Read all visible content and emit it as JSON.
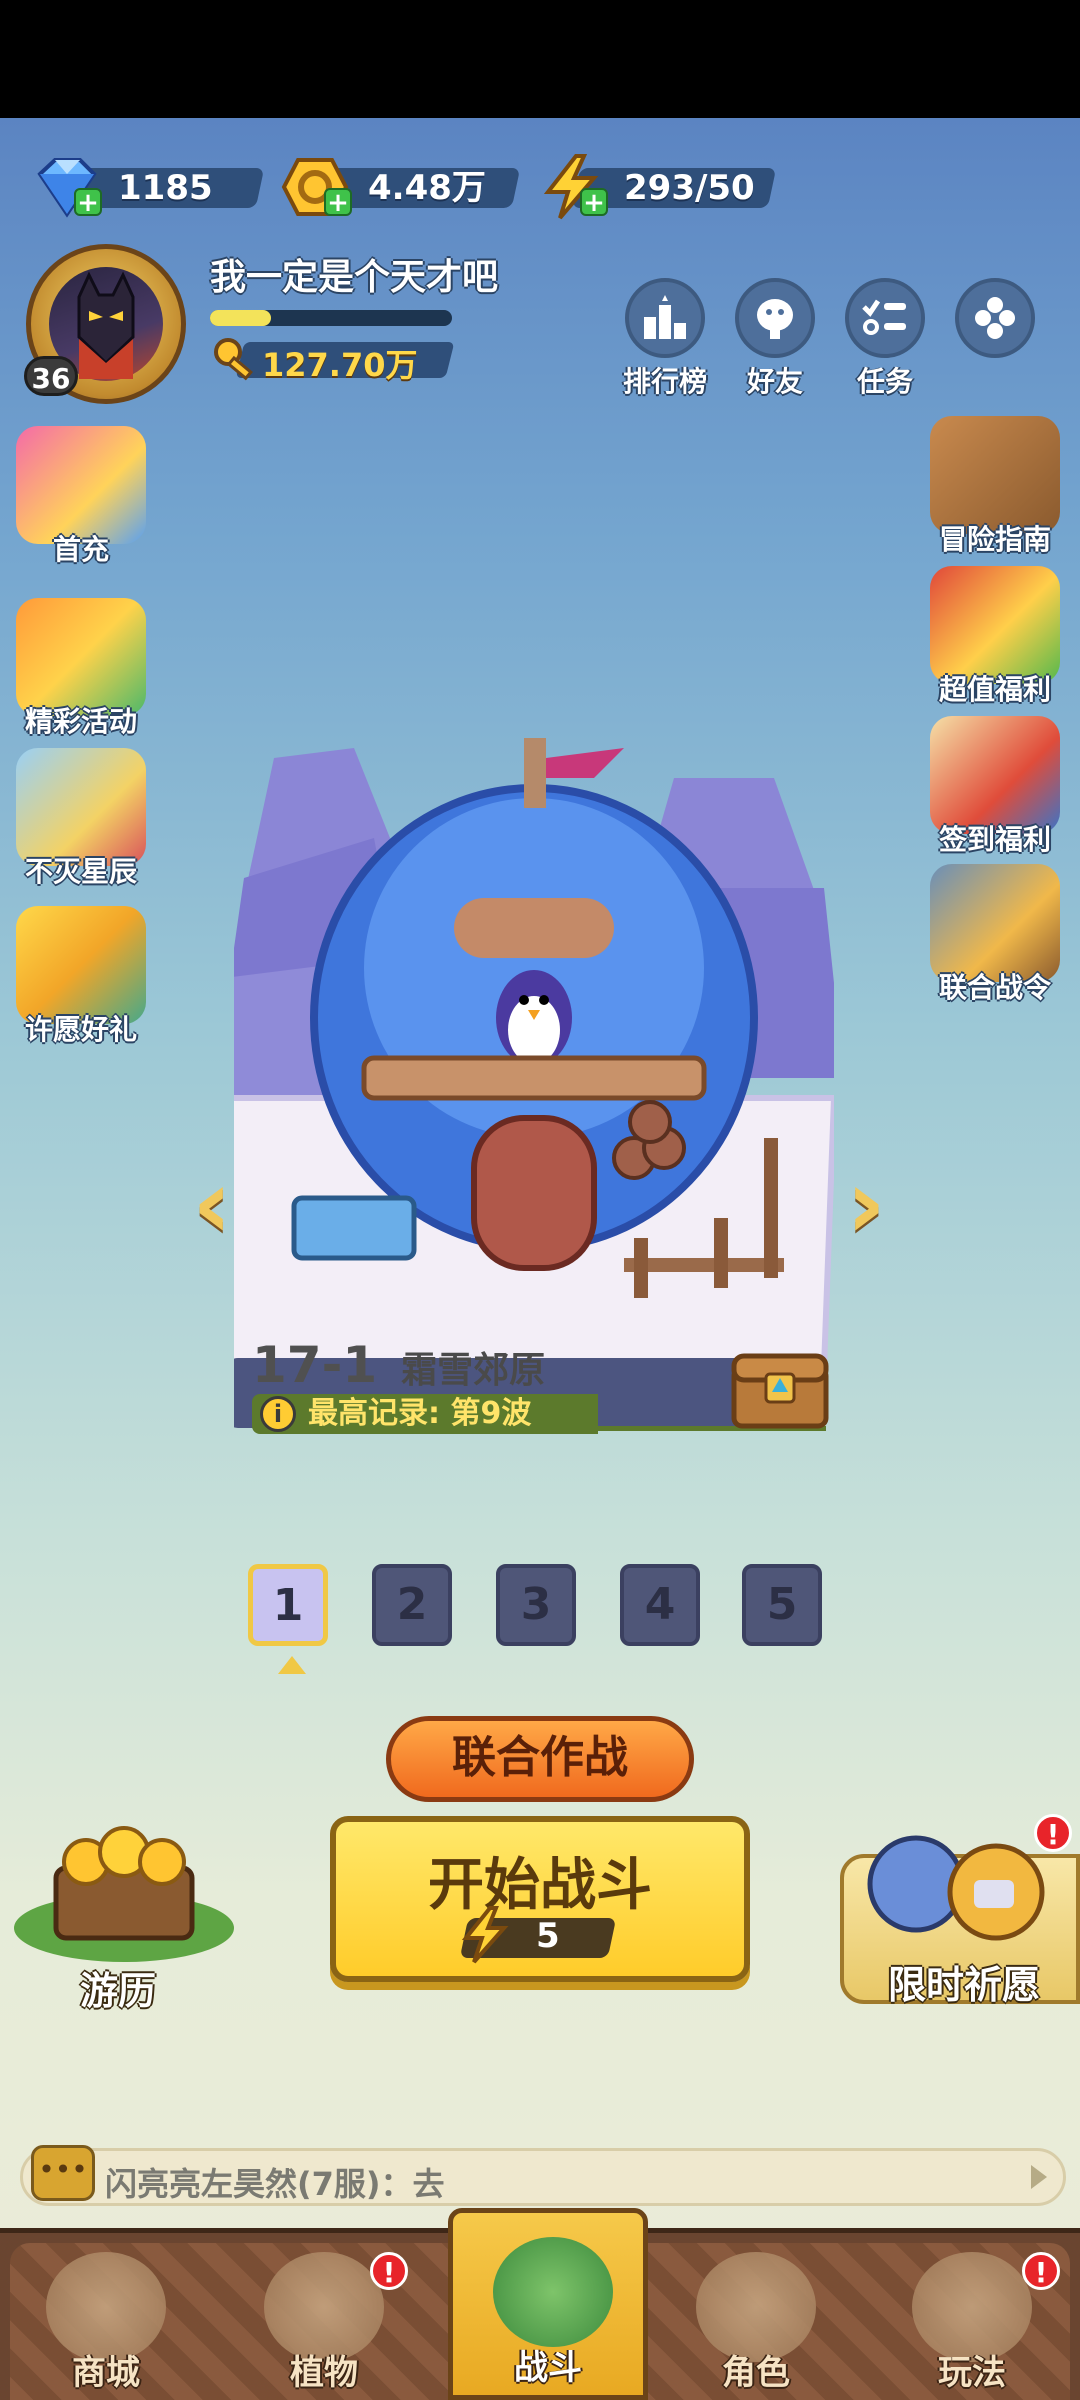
{
  "currencies": [
    {
      "name": "diamond",
      "icon": "diamond-icon",
      "value": "1185"
    },
    {
      "name": "gold",
      "icon": "gold-coin-icon",
      "value": "4.48万"
    },
    {
      "name": "energy",
      "icon": "lightning-icon",
      "value": "293/50"
    }
  ],
  "player": {
    "name": "我一定是个天才吧",
    "level": "36",
    "exp_fraction": 0.25,
    "power": "127.70万"
  },
  "top_buttons": [
    {
      "label": "排行榜",
      "icon": "leaderboard-icon"
    },
    {
      "label": "好友",
      "icon": "friends-icon"
    },
    {
      "label": "任务",
      "icon": "tasks-icon"
    },
    {
      "label": "",
      "icon": "more-icon"
    }
  ],
  "left_menu": [
    {
      "label": "首充"
    },
    {
      "label": "精彩活动"
    },
    {
      "label": "不灭星辰"
    },
    {
      "label": "许愿好礼"
    }
  ],
  "right_menu": [
    {
      "label": "冒险指南"
    },
    {
      "label": "超值福利"
    },
    {
      "label": "签到福利"
    },
    {
      "label": "联合战令"
    }
  ],
  "stage": {
    "number": "17-1",
    "name": "霜雪郊原",
    "record": "最高记录: 第9波",
    "waves": [
      "1",
      "2",
      "3",
      "4",
      "5"
    ],
    "active_wave": 1
  },
  "buttons": {
    "coop": "联合作战",
    "start": "开始战斗",
    "start_cost": "5",
    "travel": "游历",
    "prayer": "限时祈愿",
    "prayer_badge": "!"
  },
  "chat": {
    "text": "闪亮亮左昊然(7服)：去"
  },
  "bottom_nav": [
    {
      "label": "商城",
      "badge": ""
    },
    {
      "label": "植物",
      "badge": "!"
    },
    {
      "label": "战斗",
      "badge": ""
    },
    {
      "label": "角色",
      "badge": ""
    },
    {
      "label": "玩法",
      "badge": "!"
    }
  ],
  "colors": {
    "accent_gold": "#ffcc2a",
    "energy_green": "#3fc24a",
    "alert_red": "#e8242a",
    "nav_brown": "#6a4530"
  }
}
